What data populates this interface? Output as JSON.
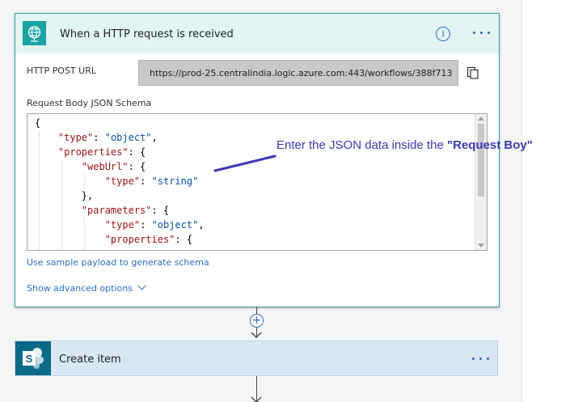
{
  "trigger": {
    "title": "When a HTTP request is received",
    "icon": "globe-request-icon",
    "accent_color": "#1ca3a3",
    "info_label": "i",
    "http_post_url_label": "HTTP POST URL",
    "http_post_url_value": "https://prod-25.centralindia.logic.azure.com:443/workflows/388f713...",
    "schema_label": "Request Body JSON Schema",
    "schema_lines": [
      {
        "text": "{"
      },
      {
        "k": "\"type\"",
        "p": ": ",
        "s": "\"object\"",
        "e": ","
      },
      {
        "k": "\"properties\"",
        "p": ": {"
      },
      {
        "k": "\"webUrl\"",
        "p": ": {"
      },
      {
        "k": "\"type\"",
        "p": ": ",
        "s": "\"string\""
      },
      {
        "text": "},"
      },
      {
        "k": "\"parameters\"",
        "p": ": {"
      },
      {
        "k": "\"type\"",
        "p": ": ",
        "s": "\"object\"",
        "e": ","
      },
      {
        "k": "\"properties\"",
        "p": ": {"
      }
    ],
    "sample_payload_link": "Use sample payload to generate schema",
    "advanced_options_link": "Show advanced options"
  },
  "annotation": {
    "text": "Enter the JSON data inside the ",
    "emphasis": "\"Request Boy\"",
    "color": "#3b3bb5"
  },
  "connector": {
    "add_label": "+"
  },
  "action": {
    "title": "Create item",
    "icon": "sharepoint-icon",
    "accent_color": "#0b6a87"
  }
}
